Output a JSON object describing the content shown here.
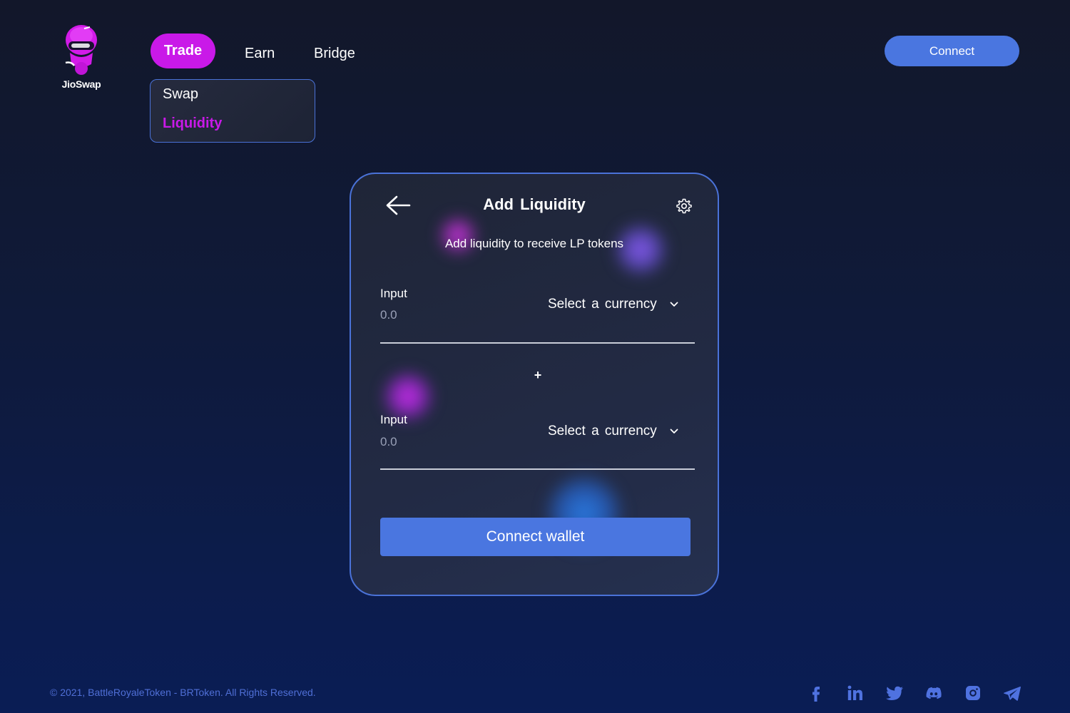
{
  "brand": {
    "name": "JioSwap",
    "accent_color": "#c919e8",
    "primary_button_color": "#4a76e0"
  },
  "nav": {
    "trade": "Trade",
    "earn": "Earn",
    "bridge": "Bridge",
    "dropdown": {
      "swap": "Swap",
      "liquidity": "Liquidity"
    }
  },
  "header": {
    "connect_label": "Connect"
  },
  "card": {
    "back_icon": "arrow-left-icon",
    "title": "Add Liquidity",
    "settings_icon": "gear-icon",
    "subtitle": "Add liquidity to receive LP tokens",
    "inputs": [
      {
        "label": "Input",
        "placeholder": "0.0",
        "currency_label": "Select a currency"
      },
      {
        "label": "Input",
        "placeholder": "0.0",
        "currency_label": "Select a currency"
      }
    ],
    "plus_symbol": "+",
    "wallet_button": "Connect wallet"
  },
  "footer": {
    "copyright": "© 2021, BattleRoyaleToken - BRToken. All Rights Reserved.",
    "social_icons": [
      "facebook-icon",
      "linkedin-icon",
      "twitter-icon",
      "discord-icon",
      "instagram-icon",
      "telegram-icon"
    ]
  }
}
